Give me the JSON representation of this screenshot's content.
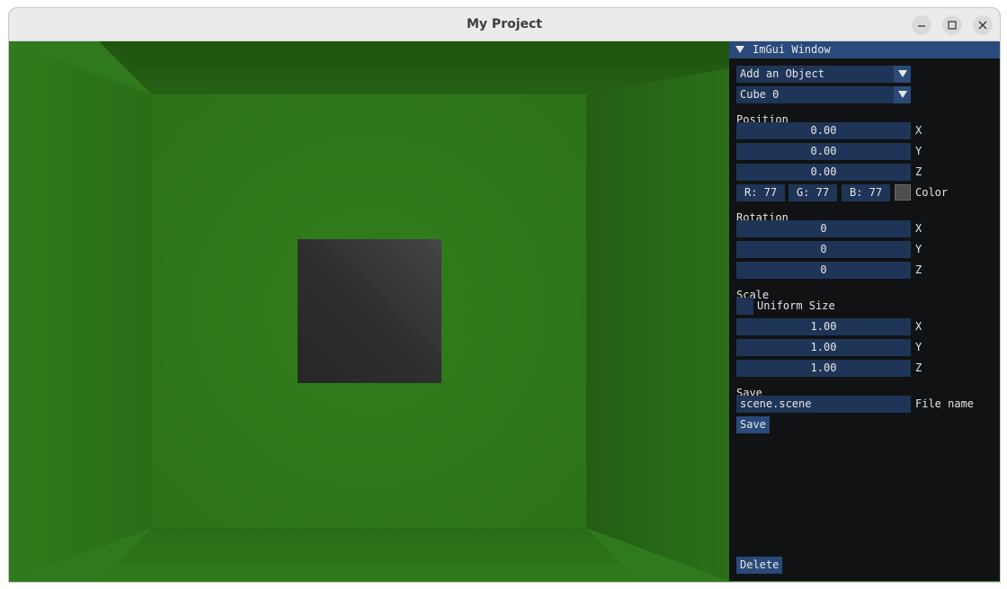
{
  "window": {
    "title": "My Project"
  },
  "panel": {
    "title": "ImGui Window",
    "add_object": "Add an Object",
    "selected_object": "Cube 0",
    "position": {
      "label": "Position",
      "x": "0.00",
      "y": "0.00",
      "z": "0.00",
      "x_label": "X",
      "y_label": "Y",
      "z_label": "Z"
    },
    "color": {
      "r": "R: 77",
      "g": "G: 77",
      "b": "B: 77",
      "label": "Color",
      "swatch_hex": "#4d4d4d"
    },
    "rotation": {
      "label": "Rotation",
      "x": "0",
      "y": "0",
      "z": "0",
      "x_label": "X",
      "y_label": "Y",
      "z_label": "Z"
    },
    "scale": {
      "label": "Scale",
      "uniform_label": "Uniform Size",
      "uniform_checked": false,
      "x": "1.00",
      "y": "1.00",
      "z": "1.00",
      "x_label": "X",
      "y_label": "Y",
      "z_label": "Z"
    },
    "save": {
      "label": "Save",
      "file_value": "scene.scene",
      "file_label": "File name",
      "button": "Save"
    },
    "delete_button": "Delete"
  },
  "colors": {
    "scene_green": "#2f7a1c",
    "panel_bg": "#101213",
    "widget_bg": "#1f3557",
    "accent": "#294a7a"
  }
}
